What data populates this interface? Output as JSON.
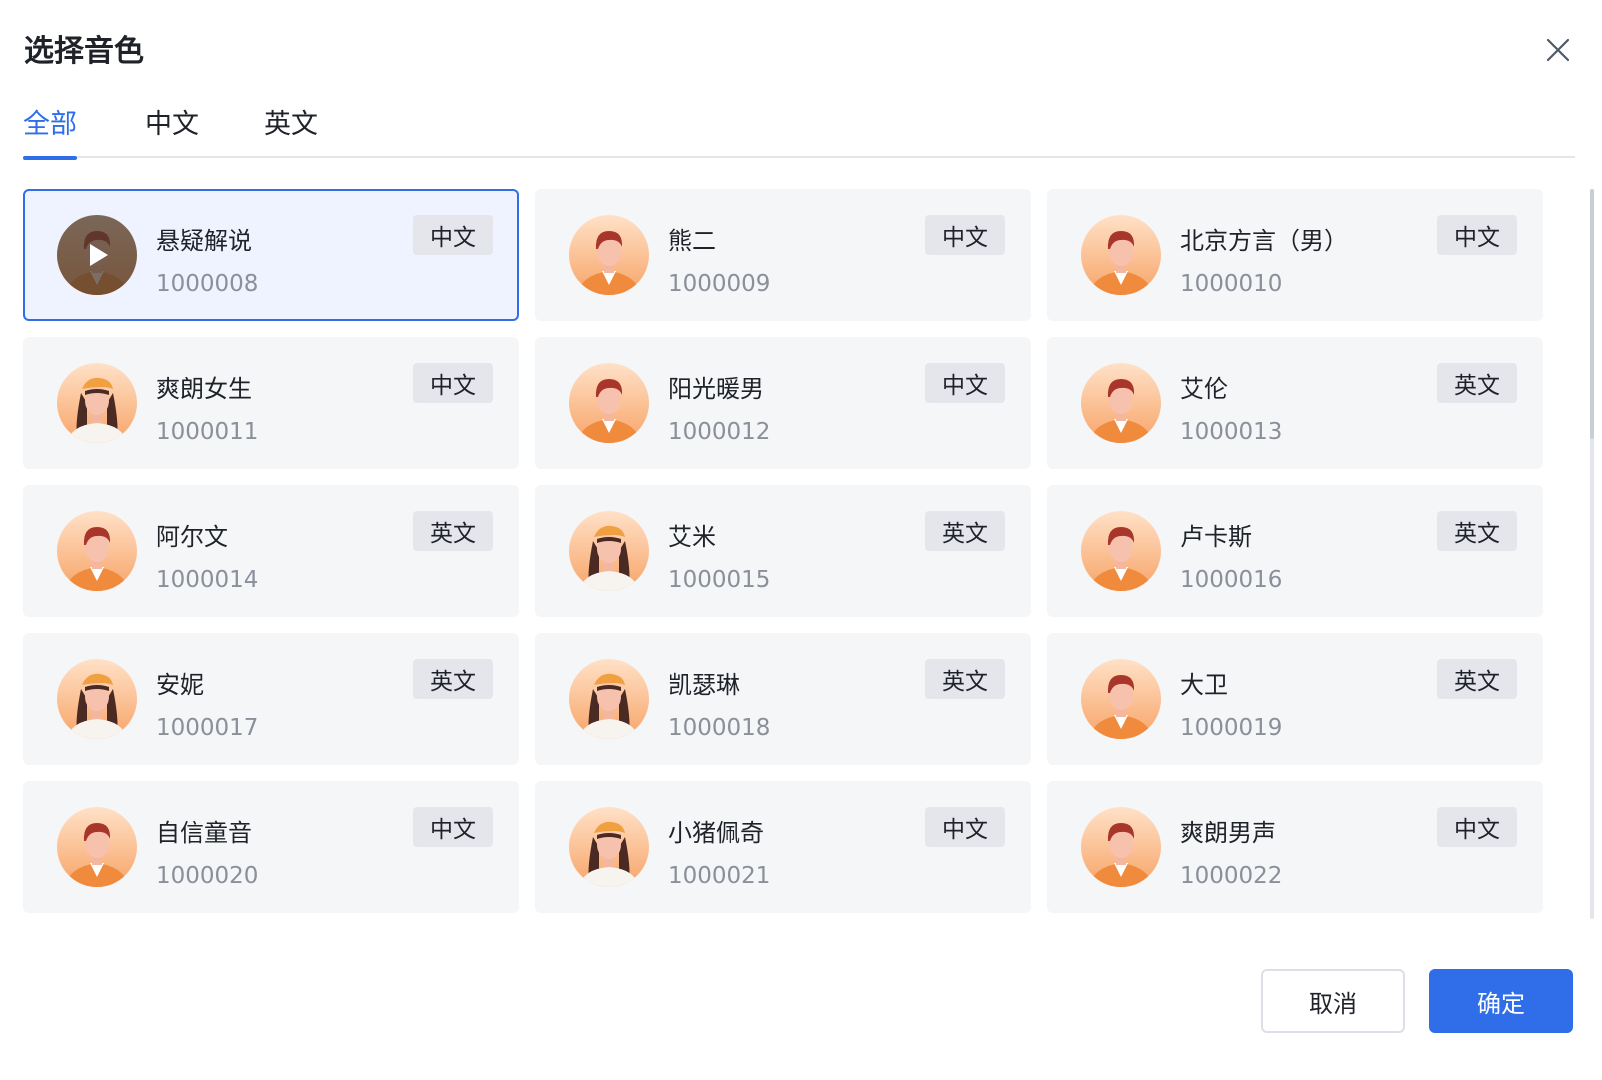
{
  "dialog": {
    "title": "选择音色",
    "close_icon": "close-icon"
  },
  "tabs": [
    {
      "label": "全部",
      "active": true
    },
    {
      "label": "中文",
      "active": false
    },
    {
      "label": "英文",
      "active": false
    }
  ],
  "voices": [
    {
      "name": "悬疑解说",
      "id": "1000008",
      "tag": "中文",
      "avatar": "male-avatar-icon",
      "selected": true,
      "playing": true
    },
    {
      "name": "熊二",
      "id": "1000009",
      "tag": "中文",
      "avatar": "male-avatar-icon"
    },
    {
      "name": "北京方言（男）",
      "id": "1000010",
      "tag": "中文",
      "avatar": "male-avatar-icon"
    },
    {
      "name": "爽朗女生",
      "id": "1000011",
      "tag": "中文",
      "avatar": "female-avatar-icon"
    },
    {
      "name": "阳光暖男",
      "id": "1000012",
      "tag": "中文",
      "avatar": "male-avatar-icon"
    },
    {
      "name": "艾伦",
      "id": "1000013",
      "tag": "英文",
      "avatar": "male-avatar-icon"
    },
    {
      "name": "阿尔文",
      "id": "1000014",
      "tag": "英文",
      "avatar": "male-avatar-icon"
    },
    {
      "name": "艾米",
      "id": "1000015",
      "tag": "英文",
      "avatar": "female-avatar-icon"
    },
    {
      "name": "卢卡斯",
      "id": "1000016",
      "tag": "英文",
      "avatar": "male-avatar-icon"
    },
    {
      "name": "安妮",
      "id": "1000017",
      "tag": "英文",
      "avatar": "female-avatar-icon"
    },
    {
      "name": "凯瑟琳",
      "id": "1000018",
      "tag": "英文",
      "avatar": "female-avatar-icon"
    },
    {
      "name": "大卫",
      "id": "1000019",
      "tag": "英文",
      "avatar": "male-avatar-icon"
    },
    {
      "name": "自信童音",
      "id": "1000020",
      "tag": "中文",
      "avatar": "male-avatar-icon"
    },
    {
      "name": "小猪佩奇",
      "id": "1000021",
      "tag": "中文",
      "avatar": "female-avatar-icon"
    },
    {
      "name": "爽朗男声",
      "id": "1000022",
      "tag": "中文",
      "avatar": "male-avatar-icon"
    }
  ],
  "footer": {
    "cancel_label": "取消",
    "confirm_label": "确定"
  },
  "colors": {
    "accent": "#2f6ee8",
    "card_bg": "#f5f6f8",
    "selected_bg": "#eef3ff",
    "tag_bg": "#e5e6eb"
  }
}
